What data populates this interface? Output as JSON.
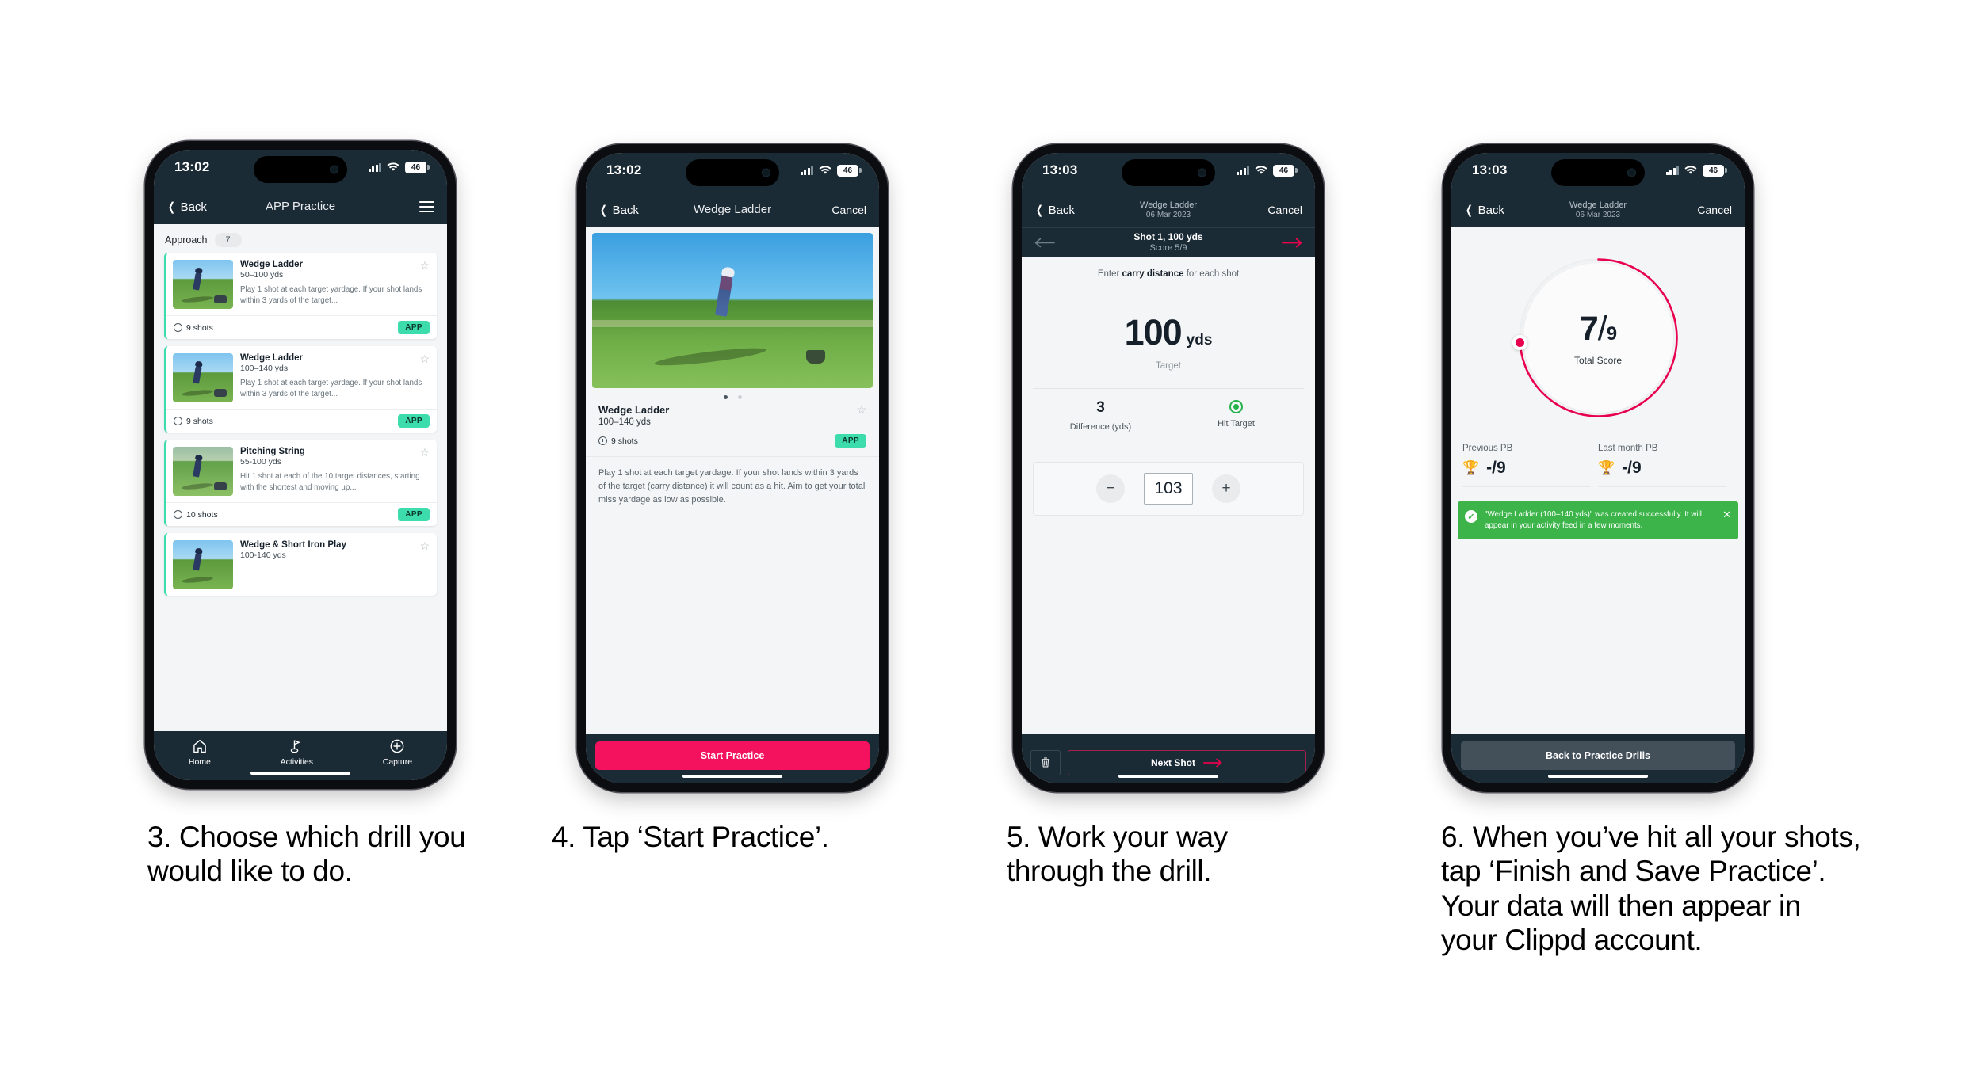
{
  "phones": [
    {
      "id": "phone-drill-list",
      "status": {
        "time": "13:02",
        "battery": "46",
        "signal_icon": "cellular-bars-icon",
        "wifi_icon": "wifi-icon"
      },
      "nav": {
        "back_label": "Back",
        "title": "APP Practice",
        "menu_icon": "hamburger-menu-icon"
      },
      "section": {
        "label": "Approach",
        "count": "7"
      },
      "cards": [
        {
          "title": "Wedge Ladder",
          "subtitle": "50–100 yds",
          "description": "Play 1 shot at each target yardage. If your shot lands within 3 yards of the target...",
          "shots": "9 shots",
          "tag": "APP",
          "star_icon": "star-outline-icon"
        },
        {
          "title": "Wedge Ladder",
          "subtitle": "100–140 yds",
          "description": "Play 1 shot at each target yardage. If your shot lands within 3 yards of the target...",
          "shots": "9 shots",
          "tag": "APP",
          "star_icon": "star-outline-icon"
        },
        {
          "title": "Pitching String",
          "subtitle": "55-100 yds",
          "description": "Hit 1 shot at each of the 10 target distances, starting with the shortest and moving up...",
          "shots": "10 shots",
          "tag": "APP",
          "star_icon": "star-outline-icon"
        },
        {
          "title": "Wedge & Short Iron Play",
          "subtitle": "100-140 yds",
          "description": "",
          "shots": "",
          "tag": "",
          "star_icon": "star-outline-icon"
        }
      ],
      "tabs": [
        {
          "label": "Home",
          "icon": "home-icon"
        },
        {
          "label": "Activities",
          "icon": "golf-flag-icon"
        },
        {
          "label": "Capture",
          "icon": "plus-circle-icon"
        }
      ]
    },
    {
      "id": "phone-drill-detail",
      "status": {
        "time": "13:02",
        "battery": "46",
        "signal_icon": "cellular-bars-icon",
        "wifi_icon": "wifi-icon"
      },
      "nav": {
        "back_label": "Back",
        "title": "Wedge Ladder",
        "cancel_label": "Cancel"
      },
      "carousel": {
        "slides": 2,
        "active": 1
      },
      "detail": {
        "title": "Wedge Ladder",
        "subtitle": "100–140 yds",
        "shots": "9 shots",
        "tag": "APP",
        "description": "Play 1 shot at each target yardage. If your shot lands within 3 yards of the target (carry distance) it will count as a hit. Aim to get your total miss yardage as low as possible.",
        "star_icon": "star-outline-icon"
      },
      "cta_label": "Start Practice"
    },
    {
      "id": "phone-shot-entry",
      "status": {
        "time": "13:03",
        "battery": "46",
        "signal_icon": "cellular-bars-icon",
        "wifi_icon": "wifi-icon"
      },
      "nav": {
        "back_label": "Back",
        "title": "Wedge Ladder",
        "subtitle": "06 Mar 2023",
        "cancel_label": "Cancel"
      },
      "subnav": {
        "prev_icon": "arrow-left-icon",
        "next_icon": "arrow-right-icon",
        "title": "Shot 1, 100 yds",
        "subtitle": "Score 5/9"
      },
      "hint": {
        "prefix": "Enter ",
        "bold": "carry distance",
        "suffix": " for each shot"
      },
      "target": {
        "value": "100",
        "unit": "yds",
        "caption": "Target"
      },
      "stats": [
        {
          "value": "3",
          "label": "Difference (yds)"
        },
        {
          "value": "",
          "label": "Hit Target",
          "icon": "target-hit-icon"
        }
      ],
      "stepper": {
        "minus": "−",
        "value": "103",
        "plus": "+"
      },
      "footer": {
        "delete_icon": "trash-icon",
        "next_label": "Next Shot",
        "next_icon": "arrow-right-icon"
      }
    },
    {
      "id": "phone-results",
      "status": {
        "time": "13:03",
        "battery": "46",
        "signal_icon": "cellular-bars-icon",
        "wifi_icon": "wifi-icon"
      },
      "nav": {
        "back_label": "Back",
        "title": "Wedge Ladder",
        "subtitle": "06 Mar 2023",
        "cancel_label": "Cancel"
      },
      "gauge": {
        "score": "7",
        "slash": "/",
        "denominator": "9",
        "caption": "Total Score",
        "accent": "#e8004e",
        "progress_pct": 75
      },
      "pbs": [
        {
          "label": "Previous PB",
          "value": "-/9",
          "icon": "trophy-icon"
        },
        {
          "label": "Last month PB",
          "value": "-/9",
          "icon": "trophy-icon"
        }
      ],
      "toast": {
        "message": "\"Wedge Ladder (100–140 yds)\" was created successfully. It will appear in your activity feed in a few moments.",
        "check_icon": "check-circle-icon",
        "close_icon": "close-icon",
        "color": "#3cb44a"
      },
      "footer_button": "Back to Practice Drills"
    }
  ],
  "captions": [
    {
      "text": "3. Choose which drill you would like to do."
    },
    {
      "text": "4. Tap ‘Start Practice’."
    },
    {
      "text": "5. Work your way through the drill."
    },
    {
      "text": "6. When you’ve hit all your shots, tap ‘Finish and Save Practice’. Your data will then appear in your Clippd account."
    }
  ],
  "theme": {
    "dark": "#1b2b36",
    "accent_pink": "#f4125e",
    "accent_teal": "#3ddcad",
    "green": "#3cb44a"
  }
}
